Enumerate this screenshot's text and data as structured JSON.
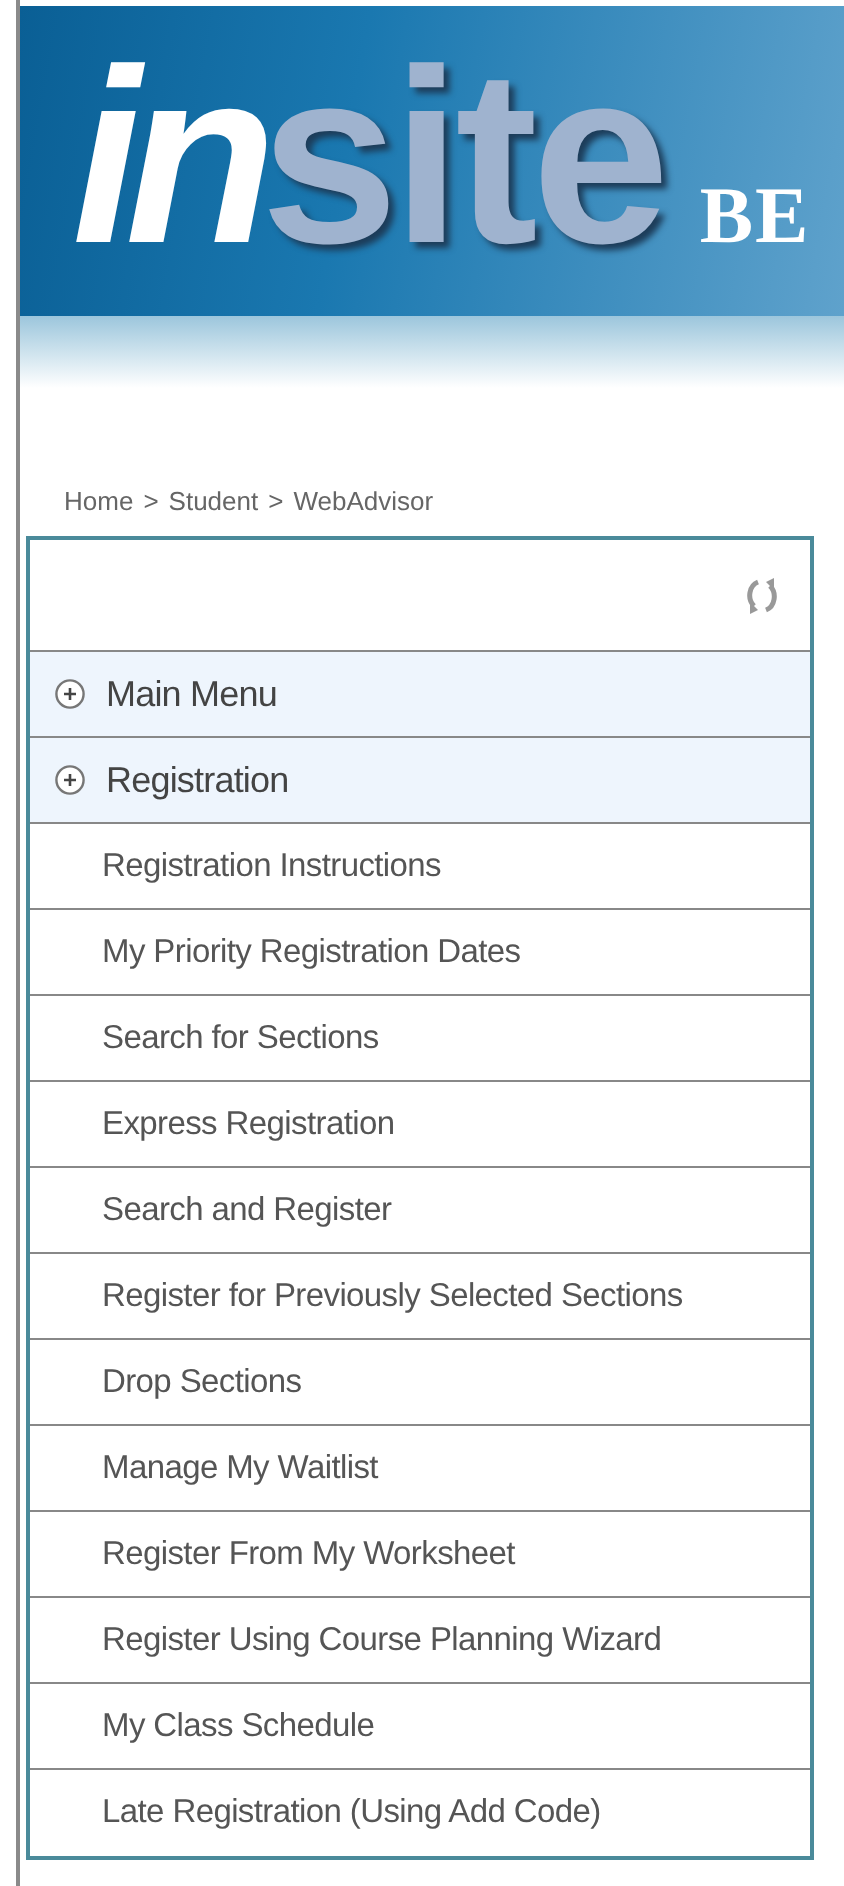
{
  "logo": {
    "prefix": "in",
    "word": "site",
    "tail": "BE"
  },
  "breadcrumb": {
    "items": [
      "Home",
      "Student",
      "WebAdvisor"
    ],
    "separator": ">"
  },
  "menu": [
    {
      "kind": "header",
      "label": "Main Menu"
    },
    {
      "kind": "header",
      "label": "Registration"
    },
    {
      "kind": "link",
      "label": "Registration Instructions"
    },
    {
      "kind": "link",
      "label": "My Priority Registration Dates"
    },
    {
      "kind": "link",
      "label": "Search for Sections"
    },
    {
      "kind": "link",
      "label": "Express Registration"
    },
    {
      "kind": "link",
      "label": "Search and Register"
    },
    {
      "kind": "link",
      "label": "Register for Previously Selected Sections"
    },
    {
      "kind": "link",
      "label": "Drop Sections"
    },
    {
      "kind": "link",
      "label": "Manage My Waitlist"
    },
    {
      "kind": "link",
      "label": "Register From My Worksheet"
    },
    {
      "kind": "link",
      "label": "Register Using Course Planning Wizard"
    },
    {
      "kind": "link",
      "label": "My Class Schedule"
    },
    {
      "kind": "link",
      "label": "Late Registration (Using Add Code)"
    }
  ]
}
